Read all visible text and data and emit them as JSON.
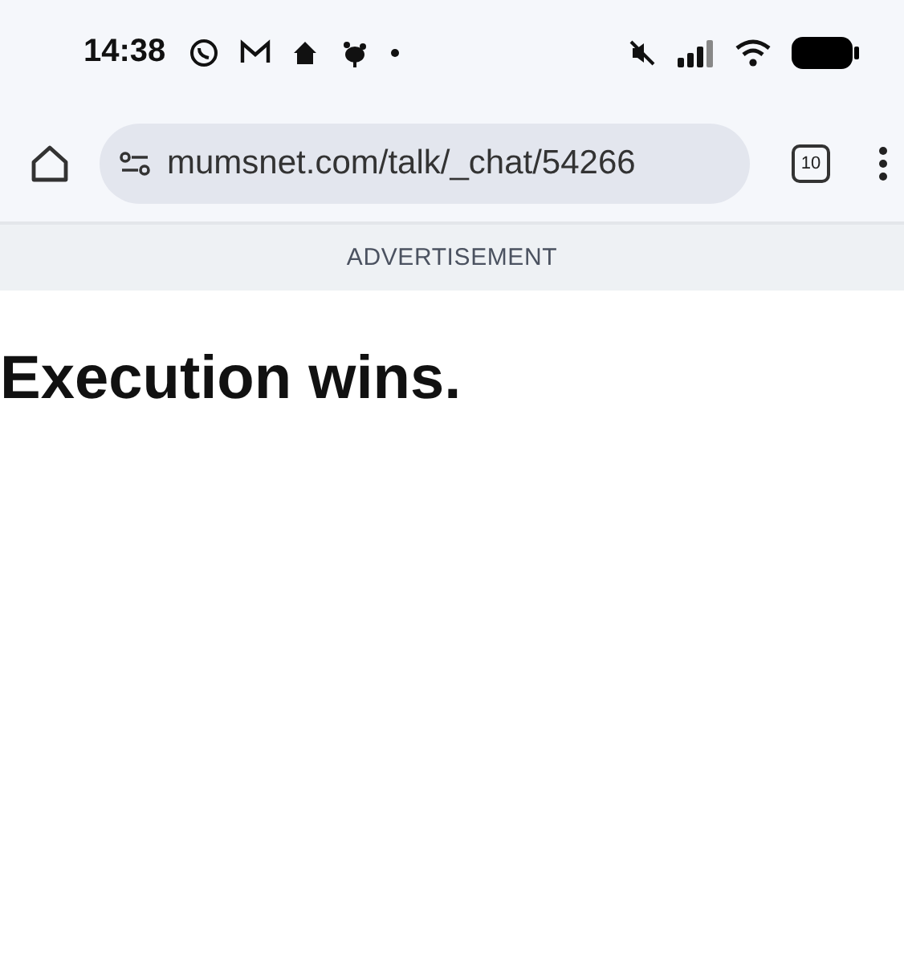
{
  "status_bar": {
    "time": "14:38"
  },
  "address_bar": {
    "url": "mumsnet.com/talk/_chat/54266",
    "tab_count": "10"
  },
  "ad_banner": {
    "label": "ADVERTISEMENT"
  },
  "article": {
    "heading": "Execution wins."
  }
}
